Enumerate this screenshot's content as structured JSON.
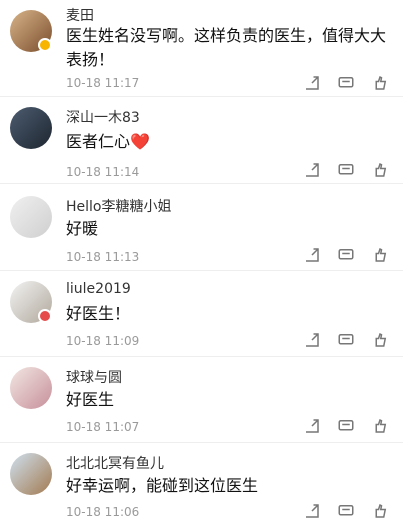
{
  "comments": [
    {
      "name": "麦田",
      "text": "医生姓名没写啊。这样负责的医生，值得大大表扬！",
      "time": "10-18 11:17"
    },
    {
      "name": "深山一木83",
      "text": "医者仁心❤️",
      "time": "10-18 11:14"
    },
    {
      "name": "Hello李糖糖小姐",
      "text": "好暖",
      "time": "10-18 11:13"
    },
    {
      "name": "liule2019",
      "text": "好医生！",
      "time": "10-18 11:09"
    },
    {
      "name": "球球与圆",
      "text": "好医生",
      "time": "10-18 11:07"
    },
    {
      "name": "北北北冥有鱼儿",
      "text": "好幸运啊，能碰到这位医生",
      "time": "10-18 11:06"
    }
  ],
  "colors": {
    "accent": "#e54b4b",
    "muted": "#9a9a9a"
  },
  "icons": [
    "share-icon",
    "comment-icon",
    "like-icon"
  ]
}
